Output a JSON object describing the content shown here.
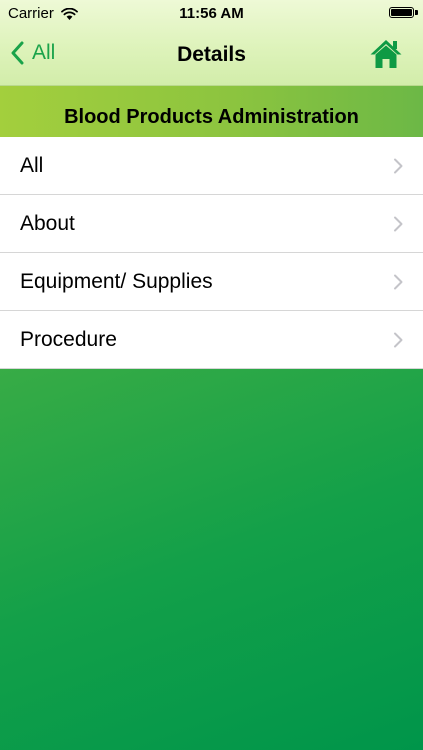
{
  "status_bar": {
    "carrier": "Carrier",
    "time": "11:56 AM"
  },
  "nav": {
    "back_label": "All",
    "title": "Details"
  },
  "section": {
    "title": "Blood Products Administration"
  },
  "list": {
    "items": [
      {
        "label": "All"
      },
      {
        "label": "About"
      },
      {
        "label": "Equipment/ Supplies"
      },
      {
        "label": "Procedure"
      }
    ]
  },
  "colors": {
    "accent": "#1aa34a",
    "header_band": "#8cc43f",
    "background_top": "#6cc03f",
    "background_bottom": "#00954a"
  },
  "icons": {
    "wifi": "wifi-icon",
    "battery": "battery-icon",
    "back": "chevron-left-icon",
    "home": "home-icon",
    "disclosure": "chevron-right-icon"
  }
}
